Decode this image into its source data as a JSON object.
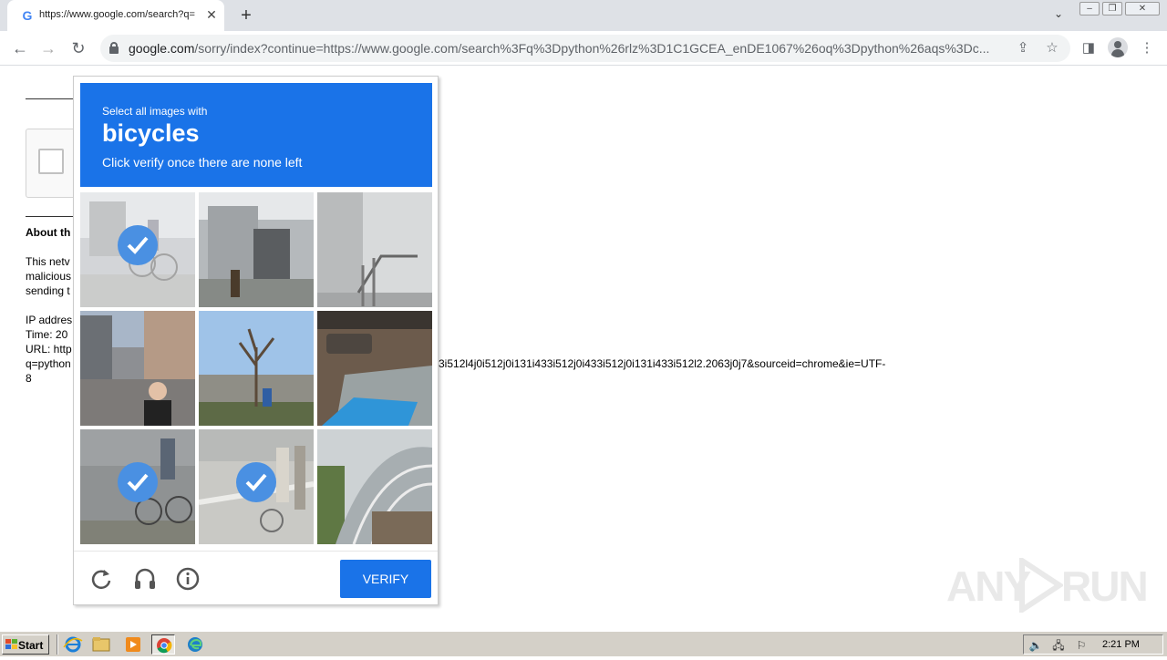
{
  "browser": {
    "tab_title": "https://www.google.com/search?q=",
    "tab_favicon": "G",
    "url_host": "google.com",
    "url_rest": "/sorry/index?continue=https://www.google.com/search%3Fq%3Dpython%26rlz%3D1C1GCEA_enDE1067%26oq%3Dpython%26aqs%3Dc...",
    "icons": [
      "back-icon",
      "forward-icon",
      "reload-icon",
      "lock-icon",
      "share-icon",
      "star-icon",
      "side-panel-icon",
      "profile-icon",
      "menu-icon"
    ]
  },
  "page": {
    "about_heading": "About th",
    "body_lines": [
      "This netv",
      "malicious",
      "sending t",
      "",
      "IP addres",
      "Time: 20",
      "URL: http",
      "q=python",
      "8"
    ],
    "url_tail": "3i512l4j0i512j0i131i433i512j0i433i512j0i131i433i512l2.2063j0j7&sourceid=chrome&ie=UTF-"
  },
  "challenge": {
    "header_line1": "Select all images with",
    "header_target": "bicycles",
    "header_line3": "Click verify once there are none left",
    "tiles": [
      {
        "selected": true
      },
      {
        "selected": false
      },
      {
        "selected": false
      },
      {
        "selected": false
      },
      {
        "selected": false
      },
      {
        "selected": false
      },
      {
        "selected": true
      },
      {
        "selected": true
      },
      {
        "selected": false
      }
    ],
    "footer_icons": [
      "reload-icon",
      "headphones-icon",
      "info-icon"
    ],
    "verify_label": "Verify",
    "accent_color": "#1a73e8",
    "check_color": "#4a90e2"
  },
  "watermark": {
    "left": "ANY",
    "right": "RUN"
  },
  "taskbar": {
    "start_label": "Start",
    "apps": [
      "ie-icon",
      "explorer-icon",
      "media-player-icon",
      "chrome-icon",
      "edge-icon"
    ],
    "active_app": "chrome-icon",
    "clock": "2:21 PM"
  }
}
